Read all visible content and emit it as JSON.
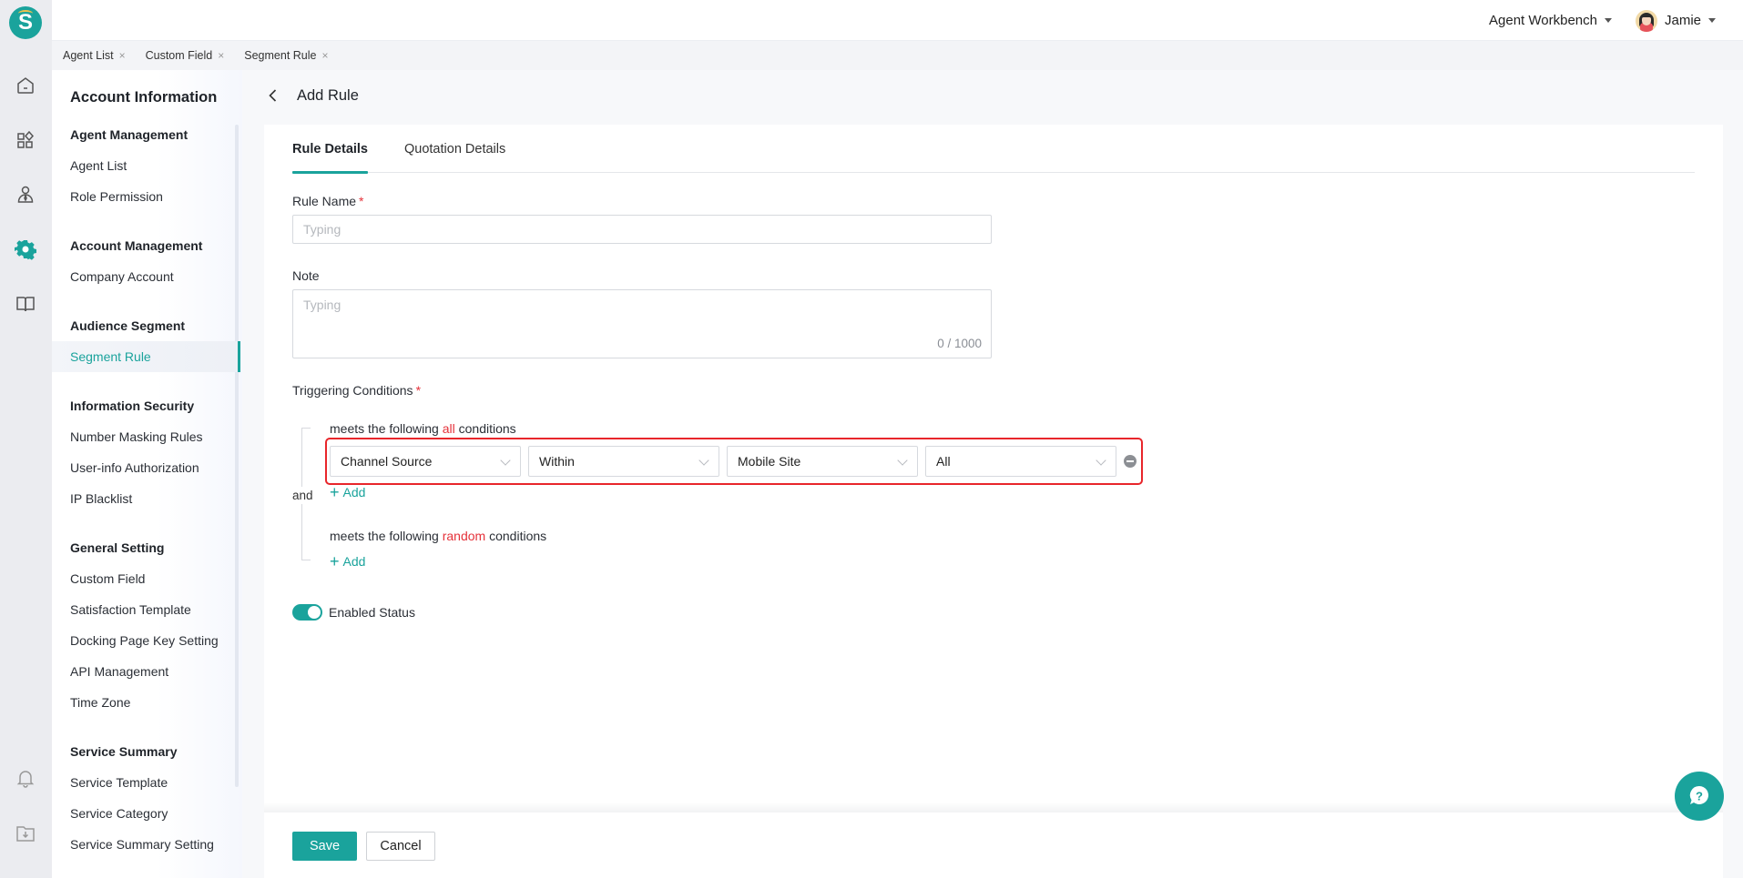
{
  "app": {
    "logo_letter": "S",
    "brand_color": "#1aa39c",
    "accent_red": "#e5323a"
  },
  "rail": {
    "items": [
      {
        "icon": "home-icon",
        "active": false
      },
      {
        "icon": "apps-icon",
        "active": false
      },
      {
        "icon": "agent-icon",
        "active": false
      },
      {
        "icon": "settings-icon",
        "active": true
      },
      {
        "icon": "book-icon",
        "active": false
      }
    ],
    "bottom": [
      {
        "icon": "bell-icon"
      },
      {
        "icon": "download-folder-icon"
      }
    ]
  },
  "topbar": {
    "workspace": "Agent Workbench",
    "user": "Jamie"
  },
  "page_tabs": [
    {
      "label": "Agent List",
      "close": "×"
    },
    {
      "label": "Custom Field",
      "close": "×"
    },
    {
      "label": "Segment Rule",
      "close": "×"
    }
  ],
  "sidebar": {
    "title": "Account Information",
    "groups": [
      {
        "heading": "Agent Management",
        "items": [
          "Agent List",
          "Role Permission"
        ]
      },
      {
        "heading": "Account Management",
        "items": [
          "Company Account"
        ]
      },
      {
        "heading": "Audience Segment",
        "items": [
          "Segment Rule"
        ]
      },
      {
        "heading": "Information Security",
        "items": [
          "Number Masking Rules",
          "User-info Authorization",
          "IP Blacklist"
        ]
      },
      {
        "heading": "General Setting",
        "items": [
          "Custom Field",
          "Satisfaction Template",
          "Docking Page Key Setting",
          "API Management",
          "Time Zone"
        ]
      },
      {
        "heading": "Service Summary",
        "items": [
          "Service Template",
          "Service Category",
          "Service Summary Setting"
        ]
      }
    ],
    "active_item": "Segment Rule"
  },
  "page": {
    "title": "Add Rule",
    "tabs": [
      {
        "label": "Rule Details",
        "active": true
      },
      {
        "label": "Quotation Details",
        "active": false
      }
    ]
  },
  "form": {
    "rule_name": {
      "label": "Rule Name",
      "required_mark": "*",
      "value": "",
      "placeholder": "Typing"
    },
    "note": {
      "label": "Note",
      "value": "",
      "placeholder": "Typing",
      "counter": "0 / 1000"
    },
    "triggering": {
      "label": "Triggering Conditions",
      "required_mark": "*",
      "joiner": "and",
      "all_group": {
        "prefix": "meets the following",
        "keyword": "all",
        "suffix": "conditions",
        "rows": [
          {
            "field": "Channel Source",
            "operator": "Within",
            "value": "Mobile Site",
            "sub_value": "All"
          }
        ],
        "add_label": "Add"
      },
      "random_group": {
        "prefix": "meets the following",
        "keyword": "random",
        "suffix": "conditions",
        "rows": [],
        "add_label": "Add"
      }
    },
    "enabled": {
      "label": "Enabled Status",
      "on": true
    }
  },
  "footer": {
    "save": "Save",
    "cancel": "Cancel"
  }
}
